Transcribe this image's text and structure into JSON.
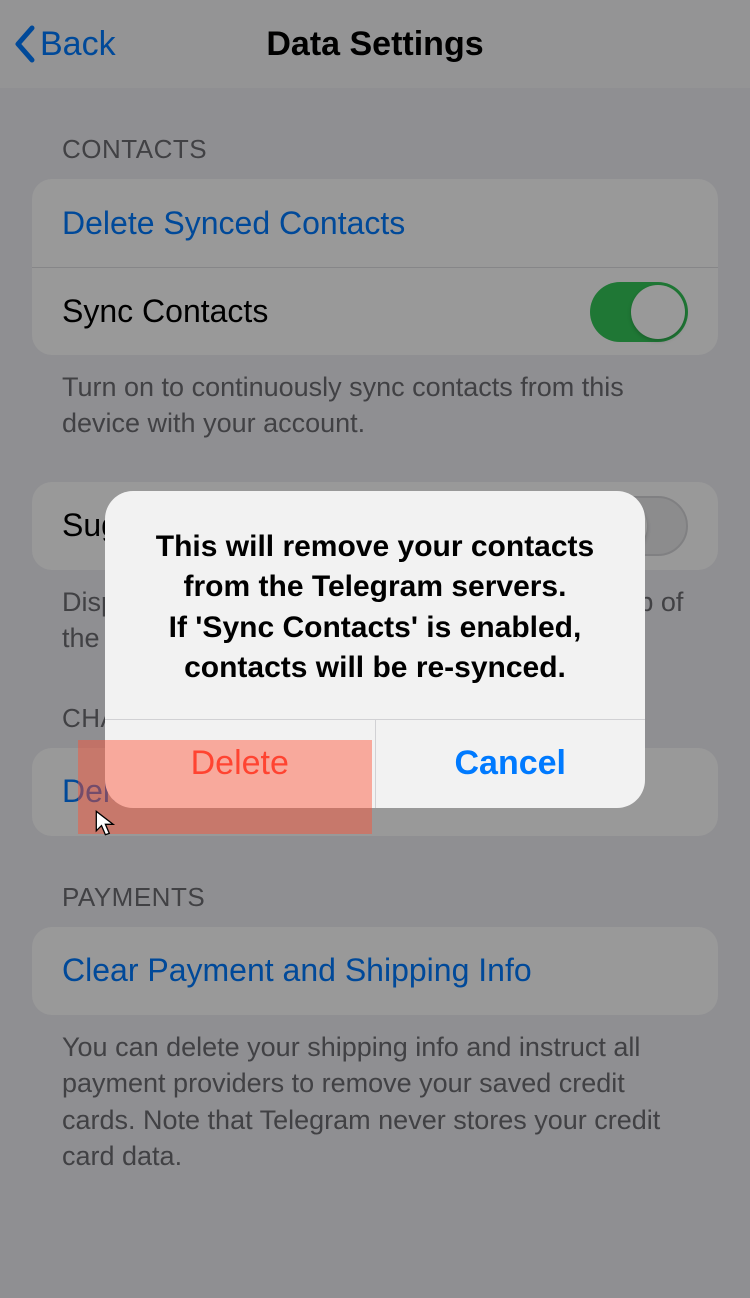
{
  "nav": {
    "back": "Back",
    "title": "Data Settings"
  },
  "contacts": {
    "header": "CONTACTS",
    "delete": "Delete Synced Contacts",
    "sync": "Sync Contacts",
    "footer": "Turn on to continuously sync contacts from this device with your account."
  },
  "suggest": {
    "label": "Suggest Frequent Contacts",
    "footer": "Display people you message frequently at the top of the search section for quick access."
  },
  "chats": {
    "header": "CHATS",
    "delete": "Delete All Cloud Drafts"
  },
  "payments": {
    "header": "PAYMENTS",
    "clear": "Clear Payment and Shipping Info",
    "footer": "You can delete your shipping info and instruct all payment providers to remove your saved credit cards. Note that Telegram never stores your credit card data."
  },
  "alert": {
    "line1": "This will remove your contacts from the Telegram servers.",
    "line2": "If 'Sync Contacts' is enabled, contacts will be re-synced.",
    "delete": "Delete",
    "cancel": "Cancel"
  }
}
